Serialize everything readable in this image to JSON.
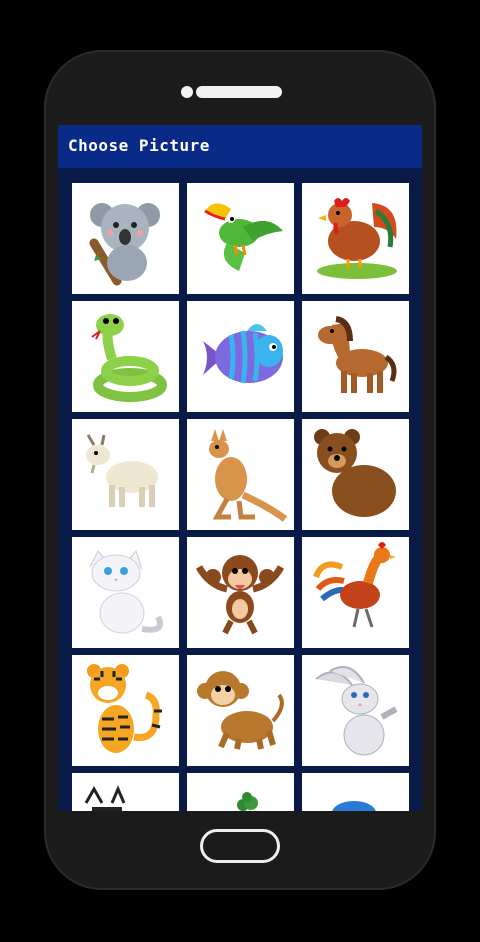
{
  "appbar": {
    "title": "Choose Picture"
  },
  "pictures": [
    {
      "name": "koala"
    },
    {
      "name": "toucan"
    },
    {
      "name": "hen"
    },
    {
      "name": "snake"
    },
    {
      "name": "fish"
    },
    {
      "name": "horse"
    },
    {
      "name": "goat"
    },
    {
      "name": "kangaroo"
    },
    {
      "name": "bear"
    },
    {
      "name": "cat"
    },
    {
      "name": "monkey-waving"
    },
    {
      "name": "rooster"
    },
    {
      "name": "tiger"
    },
    {
      "name": "monkey-sitting"
    },
    {
      "name": "rabbit"
    },
    {
      "name": "zebra"
    },
    {
      "name": "plant"
    },
    {
      "name": "bird"
    }
  ],
  "colors": {
    "appbar": "#0a2a88",
    "background": "#0a1a46",
    "tile": "#ffffff"
  }
}
